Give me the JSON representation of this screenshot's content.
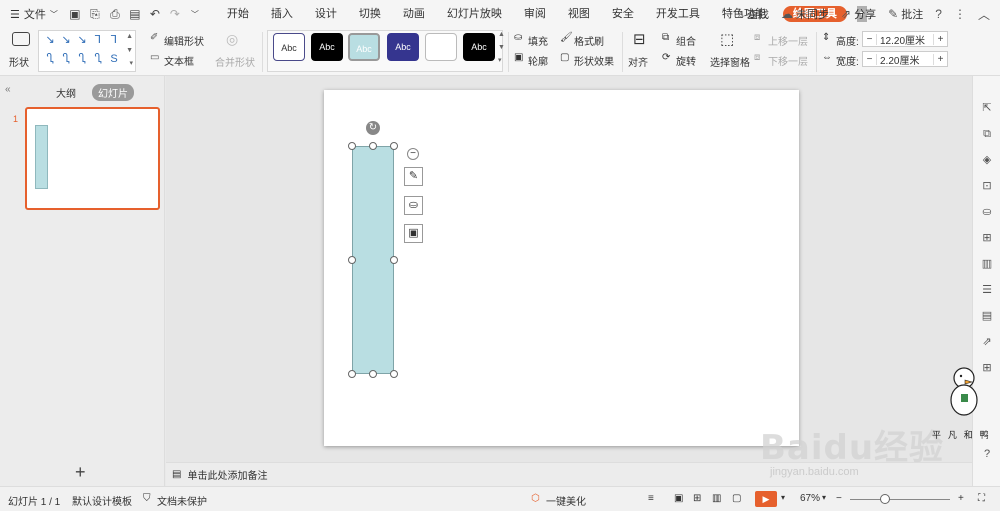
{
  "menubar": {
    "file_label": "文件",
    "tabs": [
      "开始",
      "插入",
      "设计",
      "切换",
      "动画",
      "幻灯片放映",
      "审阅",
      "视图",
      "安全",
      "开发工具",
      "特色功能"
    ],
    "active_tab": "绘图工具",
    "search_label": "查找",
    "sync_label": "未同步",
    "share_label": "分享",
    "comment_label": "批注"
  },
  "ribbon": {
    "shape_label": "形状",
    "edit_shape_label": "编辑形状",
    "textbox_label": "文本框",
    "merge_shape_label": "合并形状",
    "style_swatches": [
      "Abc",
      "Abc",
      "Abc",
      "Abc",
      "",
      "Abc"
    ],
    "fill_label": "填充",
    "format_painter_label": "格式刷",
    "outline_label": "轮廓",
    "shape_effect_label": "形状效果",
    "align_label": "对齐",
    "group_label": "组合",
    "rotate_label": "旋转",
    "selection_pane_label": "选择窗格",
    "bring_forward_label": "上移一层",
    "send_backward_label": "下移一层",
    "height_label": "高度:",
    "height_value": "12.20厘米",
    "width_label": "宽度:",
    "width_value": "2.20厘米"
  },
  "leftpanel": {
    "outline_tab": "大纲",
    "slides_tab": "幻灯片",
    "slide_number": "1",
    "add_icon": "+"
  },
  "notes": {
    "placeholder": "单击此处添加备注"
  },
  "statusbar": {
    "slide_info": "幻灯片 1 / 1",
    "template": "默认设计模板",
    "protect": "文档未保护",
    "beautify": "一键美化",
    "zoom": "67%"
  },
  "watermark": {
    "brand": "Baidu经验",
    "url": "jingyan.baidu.com",
    "duck_caption": "平 凡 和 鸭"
  },
  "colors": {
    "accent": "#e6602d",
    "shape_fill": "#b9dee2",
    "shape_border": "#7fa4a8"
  }
}
